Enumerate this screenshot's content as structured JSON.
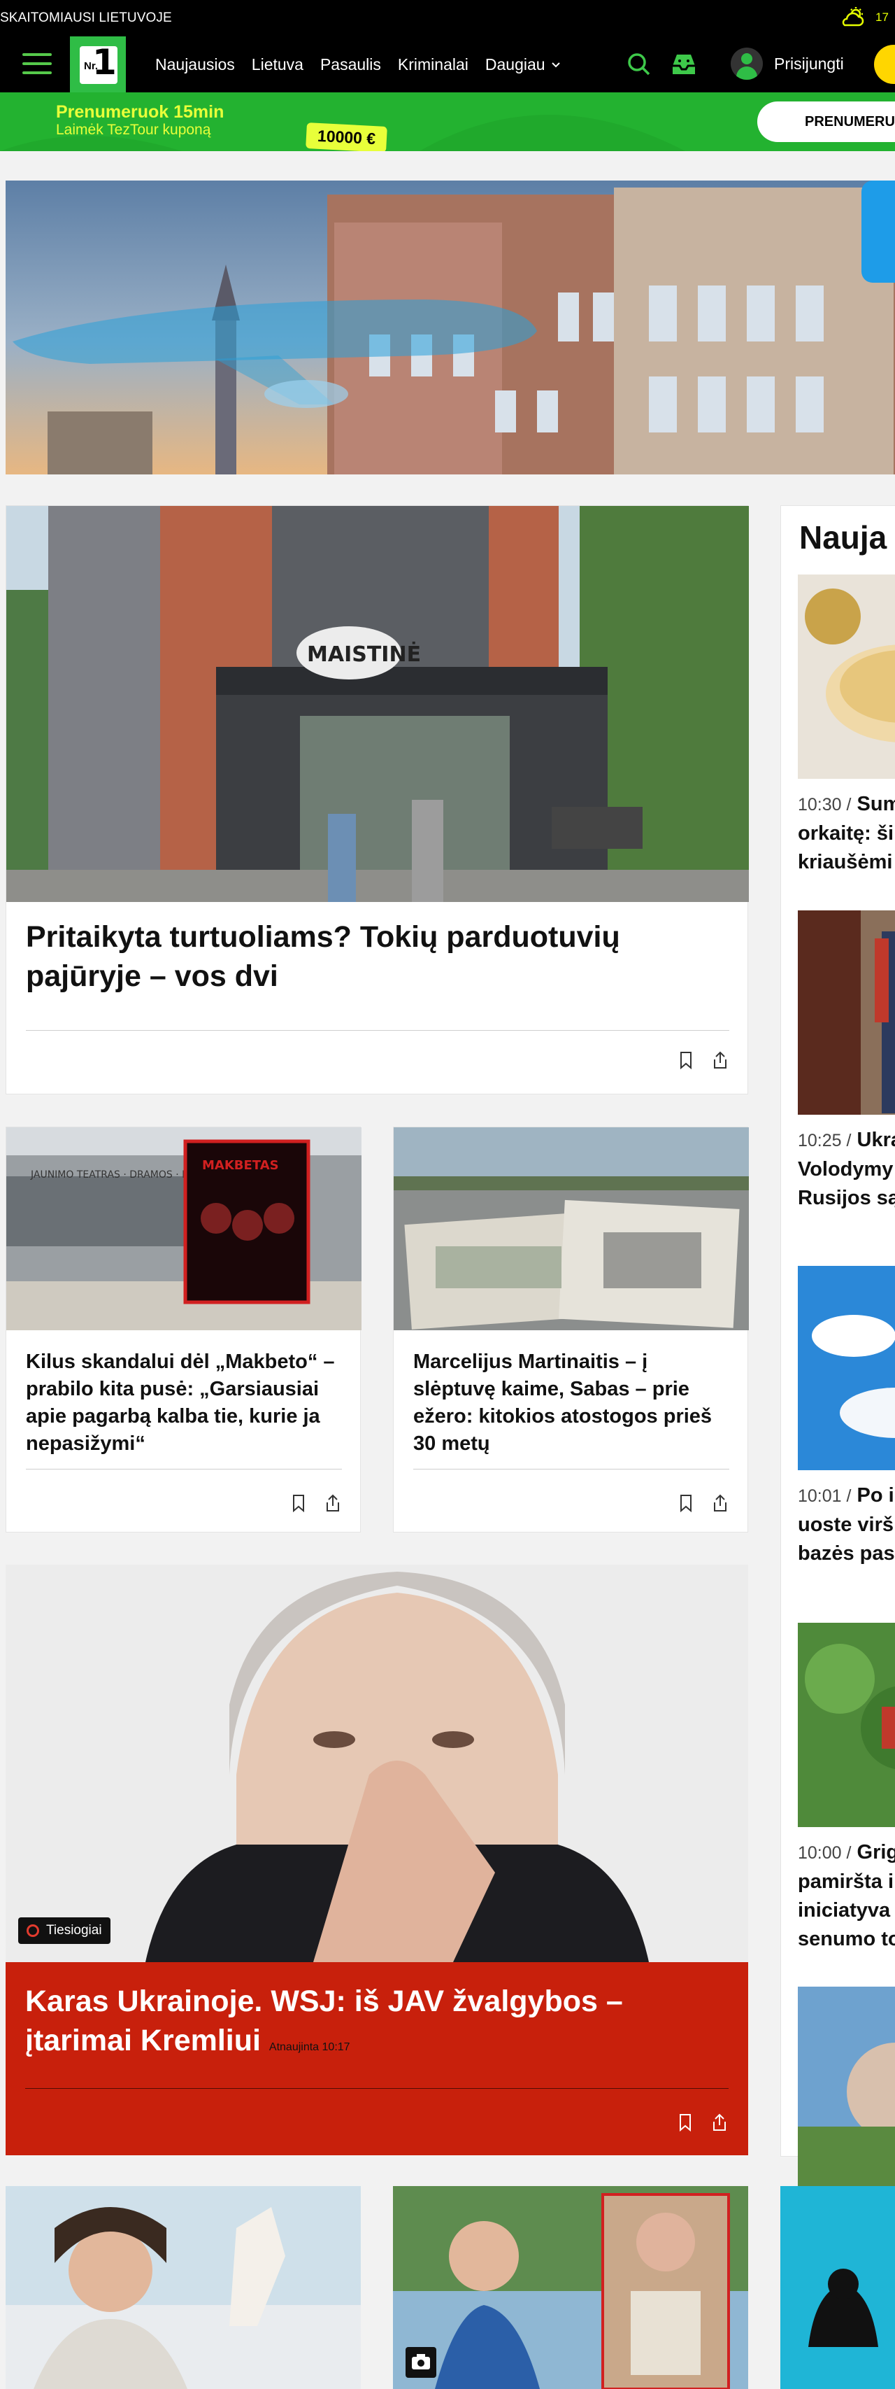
{
  "topbar": {
    "tagline": "SKAITOMIAUSI LIETUVOJE",
    "temperature": "17"
  },
  "nav": {
    "logo": {
      "nr": "Nr.",
      "one": "1"
    },
    "menu": [
      "Naujausios",
      "Lietuva",
      "Pasaulis",
      "Kriminalai",
      "Daugiau"
    ],
    "login_label": "Prisijungti"
  },
  "promo": {
    "line1": "Prenumeruok 15min",
    "line2": "Laimėk TezTour kuponą",
    "price": "10000 €",
    "button": "PRENUMERUO"
  },
  "featured": {
    "headline": "Pritaikyta turtuoliams? Tokių parduotuvių pajūryje – vos dvi"
  },
  "articles": [
    {
      "headline": "Kilus skandalui dėl „Makbeto“ – prabilo kita pusė: „Garsiausiai apie pagarbą kalba tie, kurie ja nepasižymi“"
    },
    {
      "headline": "Marcelijus Martinaitis – į slėptuvę kaime, Sabas – prie ežero: kitokios atostogos prieš 30 metų"
    }
  ],
  "live": {
    "badge": "Tiesiogiai",
    "title": "Karas Ukrainoje. WSJ: iš JAV žvalgybos – įtarimai Kremliui",
    "updated": "Atnaujinta 10:17"
  },
  "sidebar": {
    "title": "Nauja",
    "items": [
      {
        "time": "10:30 /",
        "lines": [
          "Sum",
          "orkaitę: ši",
          "kriaušėmi"
        ]
      },
      {
        "time": "10:25 /",
        "lines": [
          "Ukra",
          "Volodymy",
          "Rusijos są"
        ]
      },
      {
        "time": "10:01 /",
        "lines": [
          "Po in",
          "uoste virš",
          "bazės pas"
        ]
      },
      {
        "time": "10:00 /",
        "lines": [
          "Grig",
          "pamiršta i",
          "iniciatyva",
          "senumo to"
        ]
      }
    ]
  },
  "colors": {
    "brand_green": "#23b230",
    "accent_yellow": "#e8ff3a",
    "live_red": "#c8200c"
  }
}
